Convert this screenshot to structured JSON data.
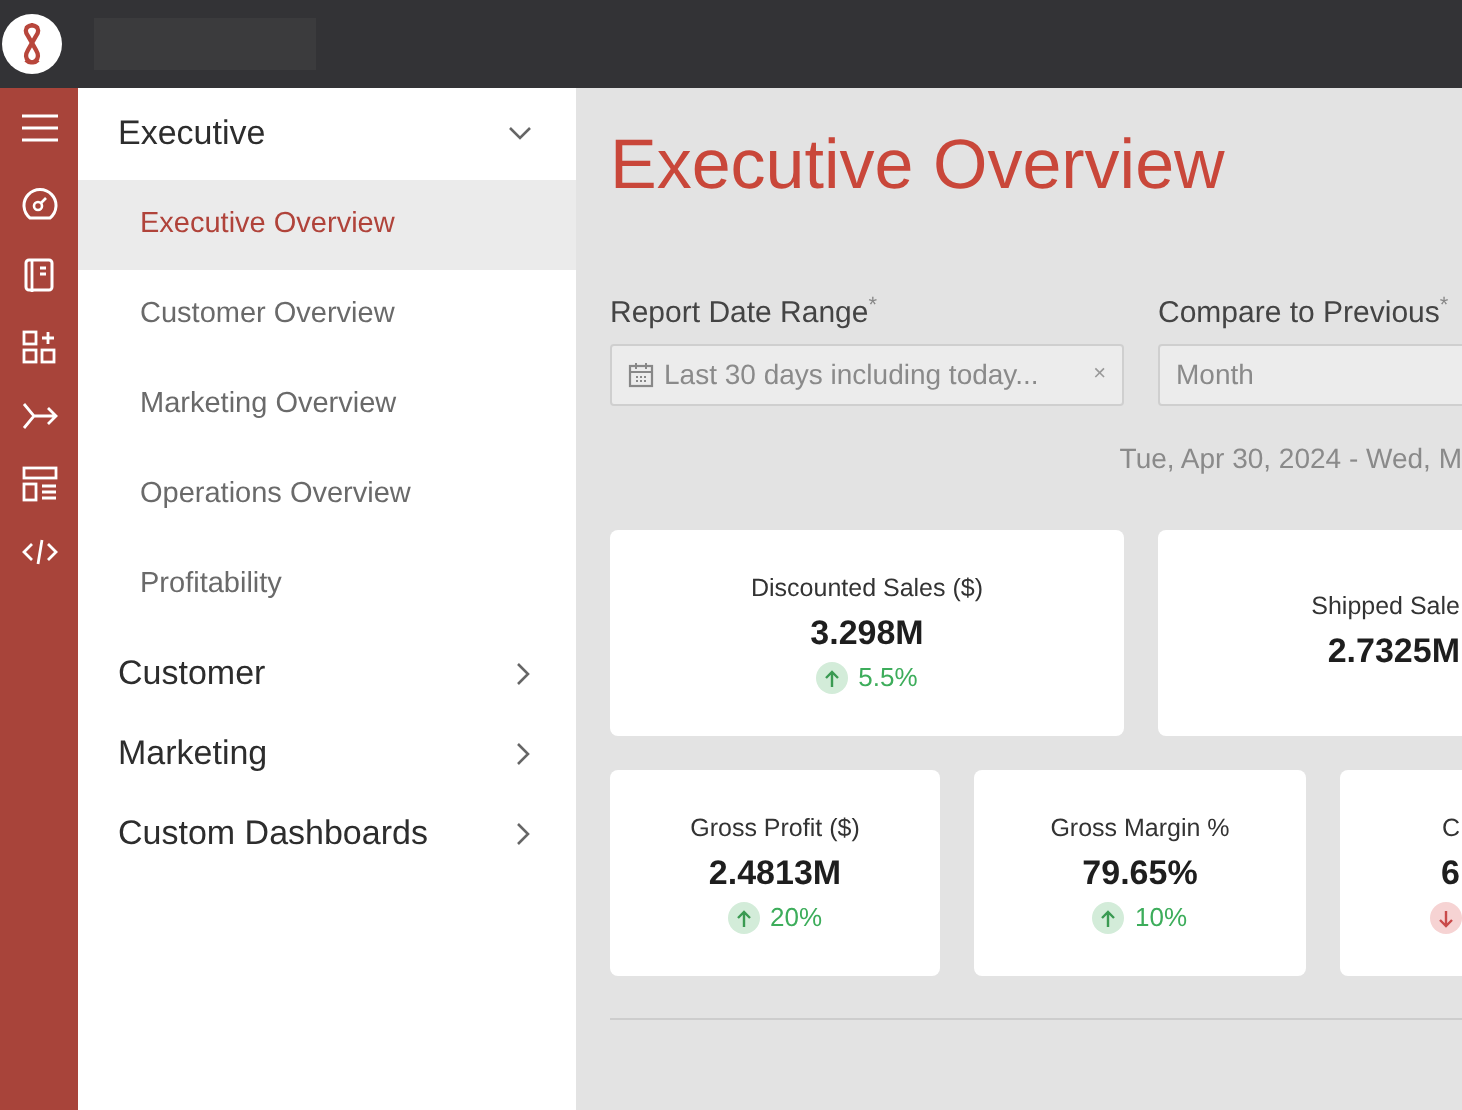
{
  "nav": {
    "groups": [
      {
        "label": "Executive",
        "expanded": true,
        "items": [
          {
            "label": "Executive Overview",
            "selected": true
          },
          {
            "label": "Customer Overview",
            "selected": false
          },
          {
            "label": "Marketing Overview",
            "selected": false
          },
          {
            "label": "Operations Overview",
            "selected": false
          },
          {
            "label": "Profitability",
            "selected": false
          }
        ]
      },
      {
        "label": "Customer",
        "expanded": false
      },
      {
        "label": "Marketing",
        "expanded": false
      },
      {
        "label": "Custom Dashboards",
        "expanded": false
      }
    ]
  },
  "page_title": "Executive Overview",
  "filters": [
    {
      "label": "Report Date Range",
      "required_mark": "*",
      "value": "Last 30 days including today...",
      "kind": "date",
      "clear_icon": "×"
    },
    {
      "label": "Compare to Previous",
      "required_mark": "*",
      "value": "Month",
      "kind": "select"
    }
  ],
  "date_range": "Tue, Apr 30, 2024 - Wed, M",
  "kpi_rows": [
    [
      {
        "label": "Discounted Sales ($)",
        "value": "3.298M",
        "change": "5.5%",
        "positive": true
      },
      {
        "label": "Shipped Sale",
        "value": "2.7325M"
      }
    ],
    [
      {
        "label": "Gross Profit ($)",
        "value": "2.4813M",
        "change": "20%",
        "positive": true
      },
      {
        "label": "Gross Margin %",
        "value": "79.65%",
        "change": "10%",
        "positive": true
      },
      {
        "label": "C",
        "value": "6",
        "positive": false
      }
    ]
  ]
}
